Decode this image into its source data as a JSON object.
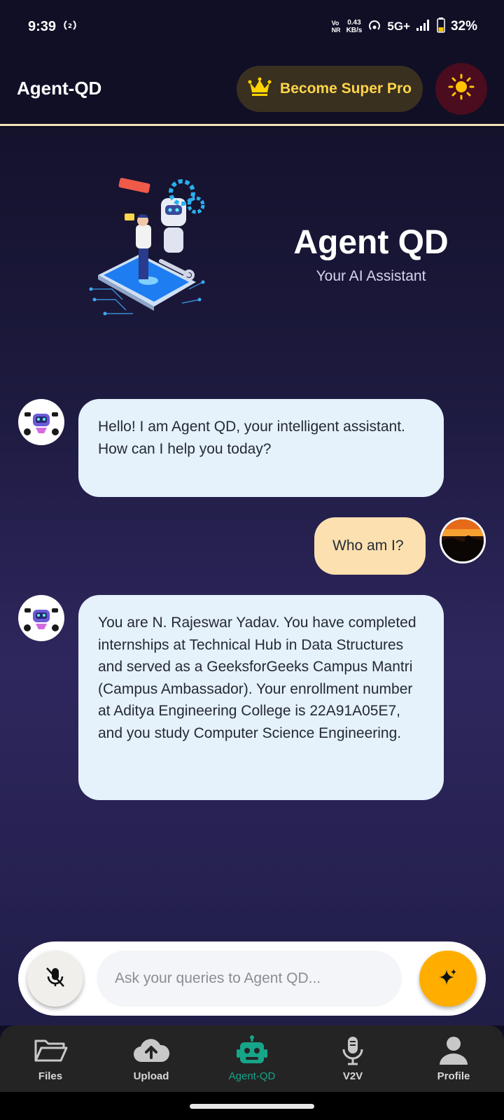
{
  "status_bar": {
    "time": "9:39",
    "vonr_top": "Vo",
    "vonr_bottom": "NR",
    "net_speed_value": "0.43",
    "net_speed_unit": "KB/s",
    "network": "5G+",
    "battery": "32%"
  },
  "app_bar": {
    "title": "Agent-QD",
    "pro_button_label": "Become Super Pro"
  },
  "hero": {
    "title": "Agent QD",
    "subtitle": "Your AI Assistant"
  },
  "messages": [
    {
      "sender": "bot",
      "text": "Hello! I am Agent QD, your intelligent assistant. How can I help you today?"
    },
    {
      "sender": "user",
      "text": "Who am I?"
    },
    {
      "sender": "bot",
      "text": "You are N. Rajeswar Yadav.  You have completed internships at Technical Hub in Data Structures and served as a GeeksforGeeks Campus Mantri (Campus Ambassador). Your enrollment number at Aditya Engineering College is 22A91A05E7, and you study Computer Science Engineering."
    }
  ],
  "input": {
    "placeholder": "Ask your queries to Agent QD..."
  },
  "bottom_nav": {
    "items": [
      {
        "label": "Files",
        "icon": "folder-icon",
        "active": false
      },
      {
        "label": "Upload",
        "icon": "cloud-upload-icon",
        "active": false
      },
      {
        "label": "Agent-QD",
        "icon": "robot-icon",
        "active": true
      },
      {
        "label": "V2V",
        "icon": "microphone-icon",
        "active": false
      },
      {
        "label": "Profile",
        "icon": "person-icon",
        "active": false
      }
    ]
  },
  "colors": {
    "accent": "#ffae00",
    "active_nav": "#17a58a",
    "pro_text": "#ffd54a",
    "bot_bubble": "#e5f1fb",
    "user_bubble": "#fde0b0"
  }
}
